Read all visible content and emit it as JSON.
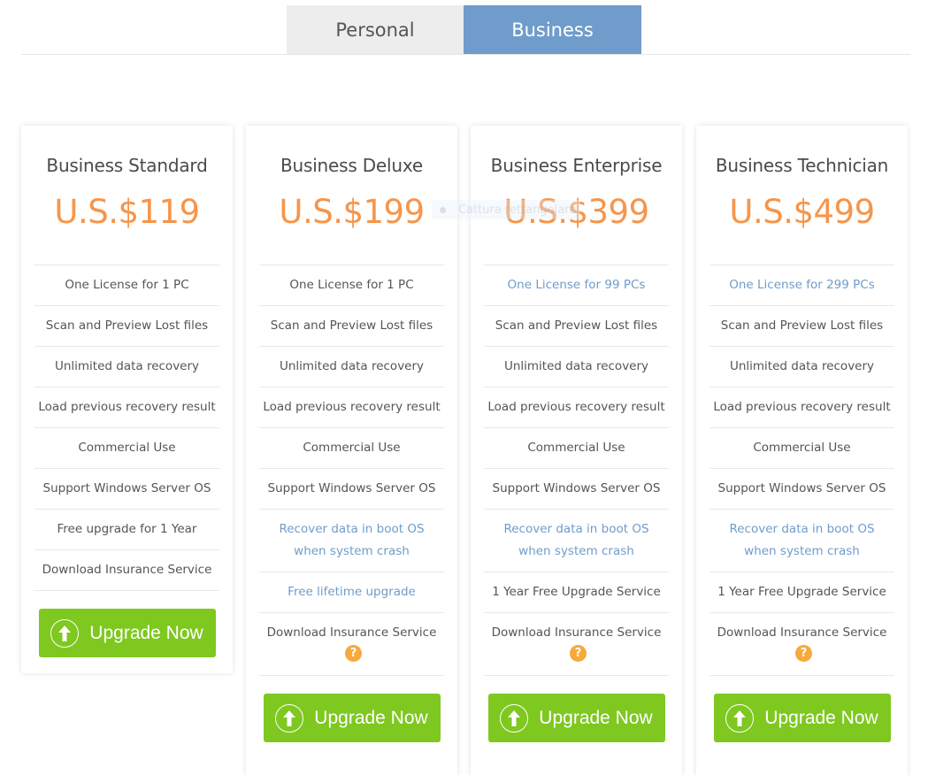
{
  "tabs": [
    {
      "label": "Personal",
      "active": false
    },
    {
      "label": "Business",
      "active": true
    }
  ],
  "colors": {
    "accent_blue": "#6f9ccb",
    "price_orange": "#f7954a",
    "button_green": "#7ec820",
    "help_orange": "#f7a93b"
  },
  "overlay": {
    "label": "Cattura rettangolare"
  },
  "plans": [
    {
      "title": "Business Standard",
      "price": "U.S.$119",
      "features": [
        {
          "text": "One License for 1 PC",
          "highlight": false
        },
        {
          "text": "Scan and Preview Lost files",
          "highlight": false
        },
        {
          "text": "Unlimited data recovery",
          "highlight": false
        },
        {
          "text": "Load previous recovery result",
          "highlight": false
        },
        {
          "text": "Commercial Use",
          "highlight": false
        },
        {
          "text": "Support Windows Server OS",
          "highlight": false
        },
        {
          "text": "Free upgrade for 1 Year",
          "highlight": false
        },
        {
          "text": "Download Insurance Service",
          "highlight": false
        }
      ],
      "button": "Upgrade Now"
    },
    {
      "title": "Business Deluxe",
      "price": "U.S.$199",
      "features": [
        {
          "text": "One License for 1 PC",
          "highlight": false
        },
        {
          "text": "Scan and Preview Lost files",
          "highlight": false
        },
        {
          "text": "Unlimited data recovery",
          "highlight": false
        },
        {
          "text": "Load previous recovery result",
          "highlight": false
        },
        {
          "text": "Commercial Use",
          "highlight": false
        },
        {
          "text": "Support Windows Server OS",
          "highlight": false
        },
        {
          "text": "Recover data in boot OS when system crash",
          "highlight": true
        },
        {
          "text": "Free lifetime upgrade",
          "highlight": true
        },
        {
          "text": "Download Insurance Service",
          "highlight": false,
          "help": "?"
        }
      ],
      "button": "Upgrade Now"
    },
    {
      "title": "Business Enterprise",
      "price": "U.S.$399",
      "features": [
        {
          "text": "One License for 99 PCs",
          "highlight": true
        },
        {
          "text": "Scan and Preview Lost files",
          "highlight": false
        },
        {
          "text": "Unlimited data recovery",
          "highlight": false
        },
        {
          "text": "Load previous recovery result",
          "highlight": false
        },
        {
          "text": "Commercial Use",
          "highlight": false
        },
        {
          "text": "Support Windows Server OS",
          "highlight": false
        },
        {
          "text": "Recover data in boot OS when system crash",
          "highlight": true
        },
        {
          "text": "1 Year Free Upgrade Service",
          "highlight": false
        },
        {
          "text": "Download Insurance Service",
          "highlight": false,
          "help": "?"
        }
      ],
      "button": "Upgrade Now"
    },
    {
      "title": "Business Technician",
      "price": "U.S.$499",
      "features": [
        {
          "text": "One License for 299 PCs",
          "highlight": true
        },
        {
          "text": "Scan and Preview Lost files",
          "highlight": false
        },
        {
          "text": "Unlimited data recovery",
          "highlight": false
        },
        {
          "text": "Load previous recovery result",
          "highlight": false
        },
        {
          "text": "Commercial Use",
          "highlight": false
        },
        {
          "text": "Support Windows Server OS",
          "highlight": false
        },
        {
          "text": "Recover data in boot OS when system crash",
          "highlight": true
        },
        {
          "text": "1 Year Free Upgrade Service",
          "highlight": false
        },
        {
          "text": "Download Insurance Service",
          "highlight": false,
          "help": "?"
        }
      ],
      "button": "Upgrade Now"
    }
  ]
}
